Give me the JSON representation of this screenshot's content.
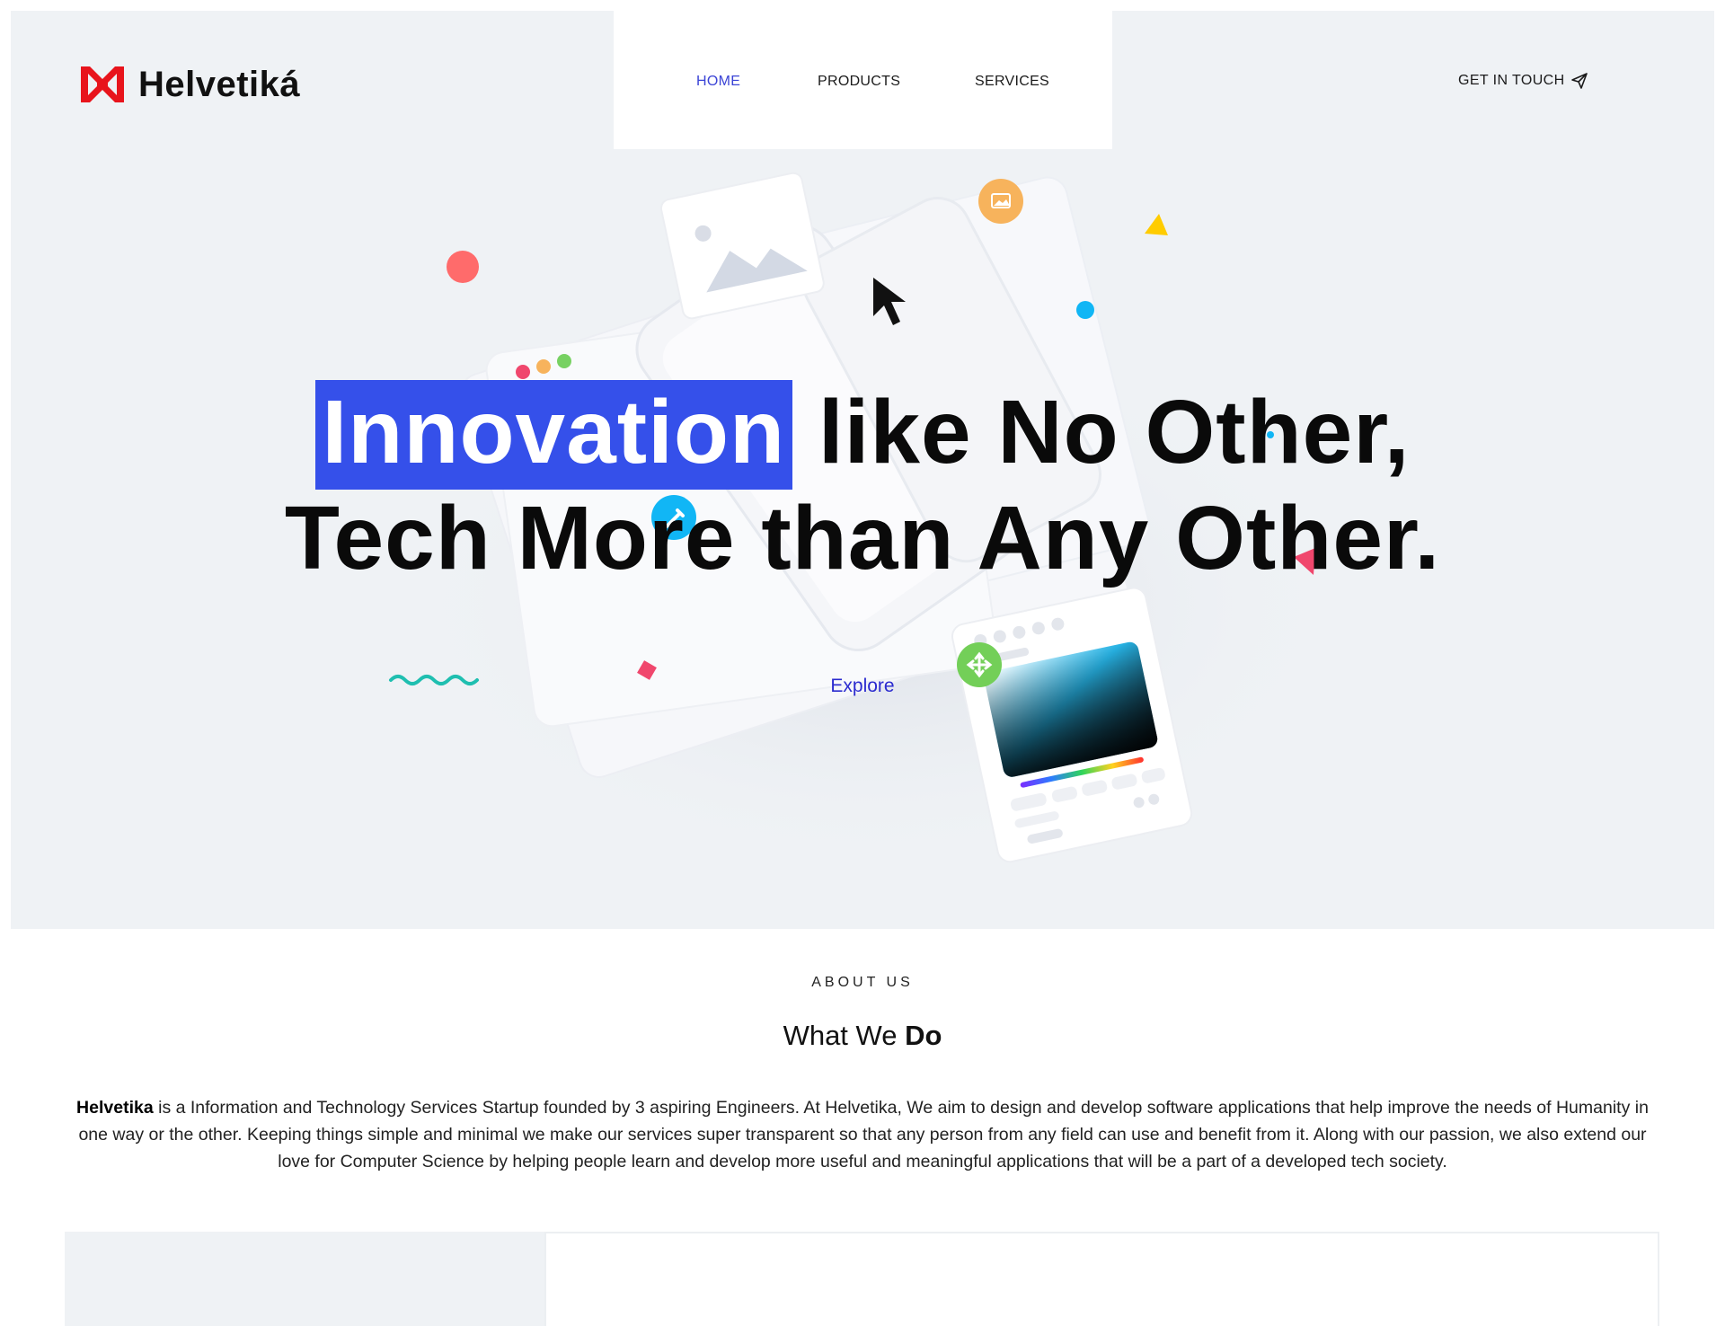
{
  "brand": {
    "name": "Helvetiká",
    "logo_icon": "helvetika-h-logo-icon",
    "accent": "#e8141c"
  },
  "nav": {
    "items": [
      {
        "label": "HOME",
        "active": true
      },
      {
        "label": "PRODUCTS",
        "active": false
      },
      {
        "label": "SERVICES",
        "active": false
      }
    ],
    "active_color": "#3b44d6"
  },
  "cta": {
    "label": "GET IN TOUCH",
    "icon": "paper-plane-icon"
  },
  "hero": {
    "highlight_word": "Innovation",
    "line1_rest": " like No Other,",
    "line2": "Tech More than Any Other.",
    "highlight_color": "#3550ea",
    "explore_label": "Explore",
    "background": "#eff2f5"
  },
  "about": {
    "eyebrow": "ABOUT US",
    "title_regular": "What We ",
    "title_bold": "Do",
    "body_bold": "Helvetika",
    "body_text": " is a Information and Technology Services Startup founded by 3 aspiring Engineers. At Helvetika, We aim to design and develop software applications that help improve the needs of Humanity in one way or the other. Keeping things simple and minimal we make our services super transparent so that any person from any field can use and benefit from it. Along with our passion, we also extend our love for Computer Science by helping people learn and develop more useful and meaningful applications that will be a part of a developed tech society."
  }
}
